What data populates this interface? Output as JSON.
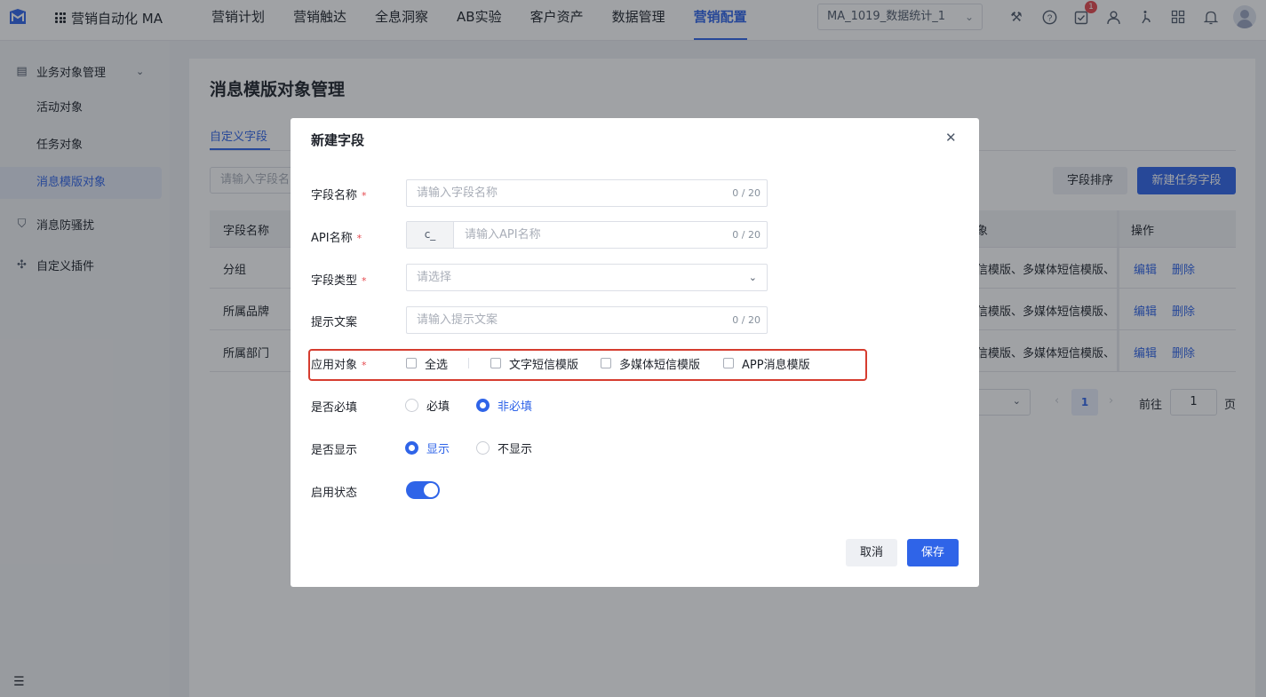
{
  "app": {
    "title": "营销自动化 MA"
  },
  "topnav": {
    "items": [
      "营销计划",
      "营销触达",
      "全息洞察",
      "AB实验",
      "客户资产",
      "数据管理",
      "营销配置"
    ],
    "active": "营销配置"
  },
  "project": {
    "value": "MA_1019_数据统计_1"
  },
  "notifications": {
    "badge": "1"
  },
  "sidebar": {
    "group_business": "业务对象管理",
    "items": [
      "活动对象",
      "任务对象",
      "消息模版对象"
    ],
    "active": "消息模版对象",
    "group_harass": "消息防骚扰",
    "group_plugin": "自定义插件"
  },
  "page": {
    "title": "消息模版对象管理",
    "tab": "自定义字段",
    "search_placeholder": "请输入字段名",
    "btn_sort": "字段排序",
    "btn_new": "新建任务字段"
  },
  "table": {
    "col_name": "字段名称",
    "col_apply_partial": "象",
    "col_ops": "操作",
    "rows": [
      {
        "name": "分组",
        "apply": "信模版、多媒体短信模版、"
      },
      {
        "name": "所属品牌",
        "apply": "信模版、多媒体短信模版、"
      },
      {
        "name": "所属部门",
        "apply": "信模版、多媒体短信模版、"
      }
    ],
    "edit_label": "编辑",
    "delete_label": "删除"
  },
  "pager": {
    "current": "1",
    "goto_label": "前往",
    "goto_value": "1",
    "unit": "页"
  },
  "modal": {
    "title": "新建字段",
    "field_name": {
      "label": "字段名称",
      "placeholder": "请输入字段名称",
      "count": "0 / 20"
    },
    "api_name": {
      "label": "API名称",
      "prefix": "c_",
      "placeholder": "请输入API名称",
      "count": "0 / 20"
    },
    "field_type": {
      "label": "字段类型",
      "placeholder": "请选择"
    },
    "hint_text": {
      "label": "提示文案",
      "placeholder": "请输入提示文案",
      "count": "0 / 20"
    },
    "apply_target": {
      "label": "应用对象",
      "select_all": "全选",
      "options": [
        "文字短信模版",
        "多媒体短信模版",
        "APP消息模版"
      ]
    },
    "required": {
      "label": "是否必填",
      "options": [
        "必填",
        "非必填"
      ],
      "selected": "非必填"
    },
    "display": {
      "label": "是否显示",
      "options": [
        "显示",
        "不显示"
      ],
      "selected": "显示"
    },
    "enabled": {
      "label": "启用状态",
      "value": true
    },
    "btn_cancel": "取消",
    "btn_save": "保存"
  },
  "colors": {
    "primary": "#2f64e8",
    "required_mark": "#e5484d",
    "highlight_box": "#d63c2f"
  }
}
